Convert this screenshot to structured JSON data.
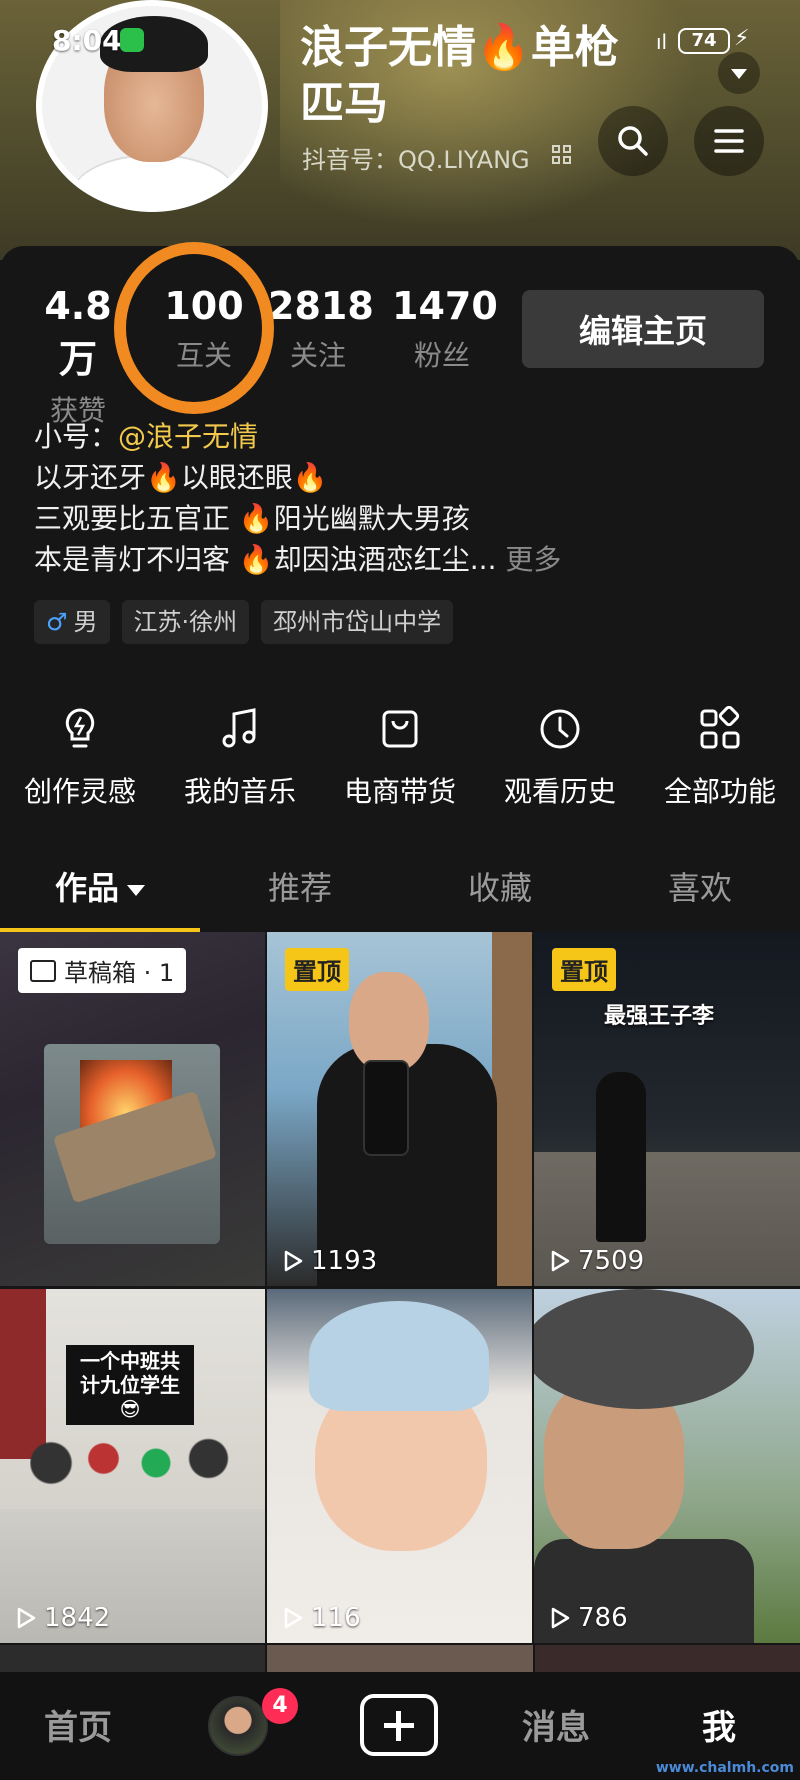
{
  "status_bar": {
    "time": "8:04",
    "battery": "74"
  },
  "profile": {
    "nickname_line1": "浪子无情🔥单枪",
    "nickname_line2": "匹马",
    "account_id": "抖音号：QQ.LIYANG"
  },
  "stats": [
    {
      "value": "4.8万",
      "label": "获赞"
    },
    {
      "value": "100",
      "label": "互关"
    },
    {
      "value": "2818",
      "label": "关注"
    },
    {
      "value": "1470",
      "label": "粉丝"
    }
  ],
  "edit_button": "编辑主页",
  "bio": {
    "alt_prefix": "小号：",
    "alt_handle": "@浪子无情",
    "line2": "以牙还牙🔥以眼还眼🔥",
    "line3": "三观要比五官正 🔥阳光幽默大男孩",
    "line4": "本是青灯不归客 🔥却因浊酒恋红尘...",
    "more": "更多"
  },
  "tags": {
    "gender": "男",
    "location": "江苏·徐州",
    "school": "邳州市岱山中学"
  },
  "shortcuts": [
    {
      "label": "创作灵感",
      "icon": "lightbulb-icon"
    },
    {
      "label": "我的音乐",
      "icon": "music-note-icon"
    },
    {
      "label": "电商带货",
      "icon": "shopping-bag-icon"
    },
    {
      "label": "观看历史",
      "icon": "clock-icon"
    },
    {
      "label": "全部功能",
      "icon": "grid-icon"
    }
  ],
  "tabs": [
    "作品",
    "推荐",
    "收藏",
    "喜欢"
  ],
  "videos": [
    {
      "badge": "草稿箱 · 1",
      "count": ""
    },
    {
      "badge": "置顶",
      "count": "1193"
    },
    {
      "badge": "置顶",
      "caption": "最强王子李",
      "count": "7509"
    },
    {
      "caption": "一个中班共计九位学生😎",
      "count": "1842"
    },
    {
      "count": "116"
    },
    {
      "count": "786"
    }
  ],
  "bottom_nav": {
    "home": "首页",
    "badge": "4",
    "messages": "消息",
    "me": "我"
  },
  "watermark": "www.chalmh.com",
  "colors": {
    "accent": "#f5c518",
    "highlight_ring": "#f28a22",
    "badge": "#ff2d55",
    "link": "#f2c94c"
  }
}
